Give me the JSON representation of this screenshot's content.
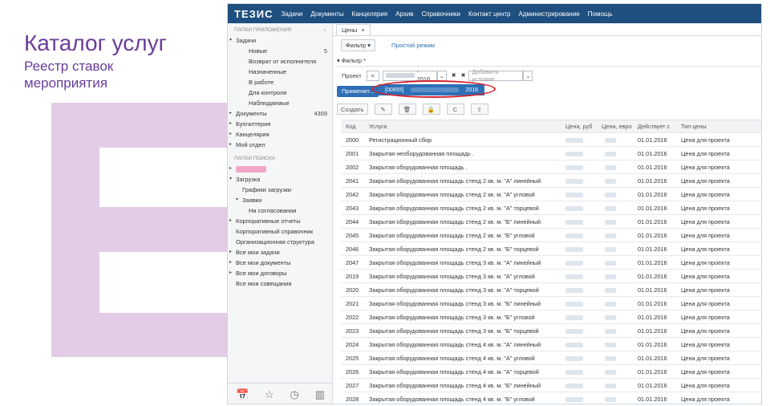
{
  "slide": {
    "title": "Каталог услуг",
    "subtitle": "Реестр ставок мероприятия"
  },
  "app": {
    "logo": "ТЕЗИС",
    "nav": [
      "Задачи",
      "Документы",
      "Канцелярия",
      "Архив",
      "Справочники",
      "Контакт центр",
      "Администрирование",
      "Помощь"
    ]
  },
  "sidebar": {
    "app_folders_label": "ПАПКИ ПРИЛОЖЕНИЯ",
    "collapse_glyph": "‹",
    "items": [
      {
        "label": "Задачи",
        "indent": 0,
        "arrow": "▾"
      },
      {
        "label": "Новые",
        "indent": 2,
        "count": "5"
      },
      {
        "label": "Возврат от исполнителя",
        "indent": 2
      },
      {
        "label": "Назначенные",
        "indent": 2
      },
      {
        "label": "В работе",
        "indent": 2
      },
      {
        "label": "Для контроля",
        "indent": 2
      },
      {
        "label": "Наблюдаемые",
        "indent": 2
      },
      {
        "label": "Документы",
        "indent": 0,
        "arrow": "▸",
        "count": "4309"
      },
      {
        "label": "Бухгалтерия",
        "indent": 0,
        "arrow": "▸"
      },
      {
        "label": "Канцелярия",
        "indent": 0,
        "arrow": "▸"
      },
      {
        "label": "Мой отдел",
        "indent": 0,
        "arrow": "▸"
      }
    ],
    "search_folders_label": "ПАПКИ ПОИСКА",
    "search_items": [
      {
        "label": "",
        "indent": 0,
        "arrow": "▸",
        "blurred": true
      },
      {
        "label": "Загрузка",
        "indent": 0,
        "arrow": "▾"
      },
      {
        "label": "Графики загрузки",
        "indent": 1
      },
      {
        "label": "Заявки",
        "indent": 1,
        "arrow": "▾"
      },
      {
        "label": "На согласовании",
        "indent": 2
      },
      {
        "label": "Корпоративные отчеты",
        "indent": 0,
        "arrow": "▸"
      },
      {
        "label": "Корпоративный справочник",
        "indent": 0
      },
      {
        "label": "Организационная структура",
        "indent": 0
      },
      {
        "label": "Все мои задачи",
        "indent": 0,
        "arrow": "▸"
      },
      {
        "label": "Все мои документы",
        "indent": 0,
        "arrow": "▸"
      },
      {
        "label": "Все мои договоры",
        "indent": 0,
        "arrow": "▸"
      },
      {
        "label": "Все мои совещания",
        "indent": 0
      }
    ],
    "bottom_icons": [
      "calendar-icon",
      "star-icon",
      "clock-icon",
      "chart-icon"
    ]
  },
  "main": {
    "tab_label": "Цены",
    "tab_close": "×",
    "filter_button": "Фильтр ▾",
    "simple_mode_link": "Простой режим",
    "filter_header": "▾ Фильтр *",
    "condition": {
      "field": "Проект",
      "op": "=",
      "value": "- 2016",
      "clear": "✖",
      "remove": "✖",
      "add_condition_placeholder": "Добавить условие"
    },
    "apply_button": "Применит...",
    "dropdown_option_code": "[00855]",
    "dropdown_option_year": "2016",
    "toolbar": {
      "create": "Создать",
      "edit_glyph": "✎",
      "delete_glyph": "🗑",
      "lock_glyph": "🔒",
      "refresh_glyph": "C",
      "export_glyph": "⇪"
    }
  },
  "table": {
    "columns": [
      "Код",
      "Услуга",
      "Цена, руб",
      "Цена, евро",
      "Действует с",
      "Тип цены"
    ],
    "rows": [
      {
        "code": "2000",
        "service": "Регистрационный сбор",
        "date": "01.01.2016",
        "type": "Цена для проекта"
      },
      {
        "code": "2001",
        "service": "Закрытая необорудованная площадь .",
        "date": "01.01.2016",
        "type": "Цена для проекта"
      },
      {
        "code": "2002",
        "service": "Закрытая оборудованная площадь .",
        "date": "01.01.2016",
        "type": "Цена для проекта"
      },
      {
        "code": "2041",
        "service": "Закрытая оборудованная площадь стенд 2 кв. м. \"А\" линейный",
        "date": "01.01.2016",
        "type": "Цена для проекта"
      },
      {
        "code": "2042",
        "service": "Закрытая оборудованная площадь стенд 2 кв. м. \"А\" угловой",
        "date": "01.01.2016",
        "type": "Цена для проекта"
      },
      {
        "code": "2043",
        "service": "Закрытая оборудованная площадь стенд 2 кв. м. \"А\" торцевой",
        "date": "01.01.2016",
        "type": "Цена для проекта"
      },
      {
        "code": "2044",
        "service": "Закрытая оборудованная площадь стенд 2 кв. м. \"Б\" линейный",
        "date": "01.01.2016",
        "type": "Цена для проекта"
      },
      {
        "code": "2045",
        "service": "Закрытая оборудованная площадь стенд 2 кв. м. \"Б\" угловой",
        "date": "01.01.2016",
        "type": "Цена для проекта"
      },
      {
        "code": "2046",
        "service": "Закрытая оборудованная площадь стенд 2 кв. м. \"Б\" торцевой",
        "date": "01.01.2016",
        "type": "Цена для проекта"
      },
      {
        "code": "2047",
        "service": "Закрытая оборудованная площадь стенд 3 кв. м. \"А\" линейный",
        "date": "01.01.2016",
        "type": "Цена для проекта"
      },
      {
        "code": "2019",
        "service": "Закрытая оборудованная площадь стенд 3 кв. м. \"А\" угловой",
        "date": "01.01.2016",
        "type": "Цена для проекта"
      },
      {
        "code": "2020",
        "service": "Закрытая оборудованная площадь стенд 3 кв. м. \"А\" торцевой",
        "date": "01.01.2016",
        "type": "Цена для проекта"
      },
      {
        "code": "2021",
        "service": "Закрытая оборудованная площадь стенд 3 кв. м. \"Б\" линейный",
        "date": "01.01.2016",
        "type": "Цена для проекта"
      },
      {
        "code": "2022",
        "service": "Закрытая оборудованная площадь стенд 3 кв. м. \"Б\" угловой",
        "date": "01.01.2016",
        "type": "Цена для проекта"
      },
      {
        "code": "2023",
        "service": "Закрытая оборудованная площадь стенд 3 кв. м. \"Б\" торцевой",
        "date": "01.01.2016",
        "type": "Цена для проекта"
      },
      {
        "code": "2024",
        "service": "Закрытая оборудованная площадь стенд 4 кв. м. \"А\" линейный",
        "date": "01.01.2016",
        "type": "Цена для проекта"
      },
      {
        "code": "2025",
        "service": "Закрытая оборудованная площадь стенд 4 кв. м. \"А\" угловой",
        "date": "01.01.2016",
        "type": "Цена для проекта"
      },
      {
        "code": "2026",
        "service": "Закрытая оборудованная площадь стенд 4 кв. м. \"А\" торцевой",
        "date": "01.01.2016",
        "type": "Цена для проекта"
      },
      {
        "code": "2027",
        "service": "Закрытая оборудованная площадь стенд 4 кв. м. \"Б\" линейный",
        "date": "01.01.2016",
        "type": "Цена для проекта"
      },
      {
        "code": "2028",
        "service": "Закрытая оборудованная площадь стенд 4 кв. м. \"Б\" угловой",
        "date": "01.01.2016",
        "type": "Цена для проекта"
      }
    ]
  }
}
